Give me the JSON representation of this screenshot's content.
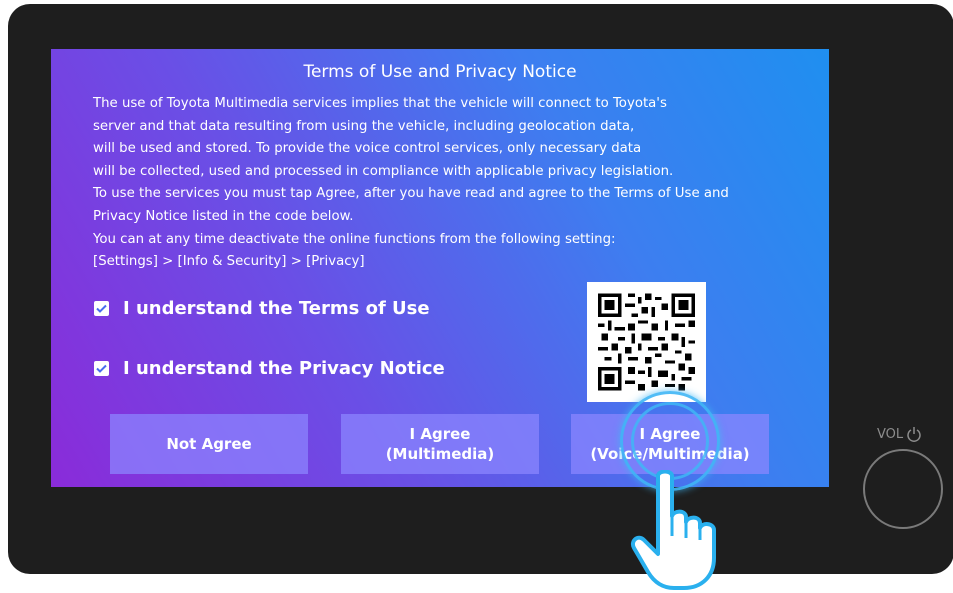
{
  "dialog": {
    "title": "Terms of Use and Privacy Notice",
    "body_lines": [
      "The use of Toyota Multimedia services implies that the vehicle will connect to Toyota's",
      "server and that data resulting from using the vehicle, including geolocation data,",
      "will be used and stored. To provide the voice control services, only necessary data",
      "will be collected, used and processed in compliance with applicable privacy legislation.",
      "To use the services you must tap Agree, after you have read and agree to the Terms of Use and",
      "Privacy Notice listed in the code below.",
      "You can at any time deactivate the online functions from the following setting:",
      "[Settings] > [Info & Security] > [Privacy]"
    ],
    "checkboxes": [
      {
        "label": "I understand the Terms of Use",
        "checked": true
      },
      {
        "label": "I understand the Privacy Notice",
        "checked": true
      }
    ],
    "buttons": {
      "not_agree": "Not Agree",
      "agree_multimedia_line1": "I Agree",
      "agree_multimedia_line2": "(Multimedia)",
      "agree_voice_line1": "I Agree",
      "agree_voice_line2": "(Voice/Multimedia)"
    }
  },
  "hardware": {
    "vol_label": "VOL"
  },
  "icons": {
    "checkbox": "checkmark-icon",
    "qr": "qr-code-icon",
    "power": "power-icon",
    "hand": "pointing-hand-icon"
  },
  "colors": {
    "bezel": "#1e1e1e",
    "gradient_start": "#8a2bd9",
    "gradient_end": "#1f8ff0",
    "button_fill": "#8c87ff",
    "checkbox_check": "#4a6cf0",
    "tap_highlight": "#3fb6f5"
  }
}
